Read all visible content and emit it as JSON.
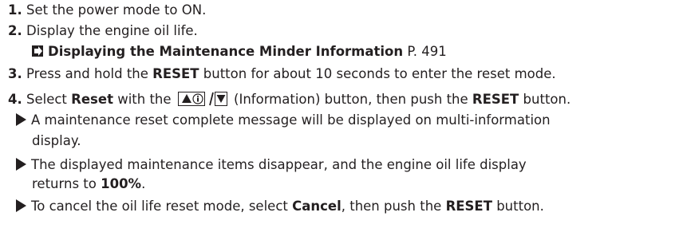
{
  "steps": [
    {
      "num": "1.",
      "text": "Set the power mode to ON."
    },
    {
      "num": "2.",
      "text": "Display the engine oil life."
    },
    {
      "num": "3.",
      "pre": "Press and hold the ",
      "bold": "RESET",
      "post": " button for about 10 seconds to enter the reset mode."
    },
    {
      "num": "4.",
      "pre": "Select ",
      "bold1": "Reset",
      "mid": " with the ",
      "button_suffix": " (Information) button, then push the ",
      "bold2": "RESET",
      "post": " button."
    }
  ],
  "reference": {
    "title": "Displaying the Maintenance Minder Information",
    "page": "P. 491"
  },
  "substeps": [
    {
      "line1": "A maintenance reset complete message will be displayed on multi-information",
      "line2": "display."
    },
    {
      "line1": "The displayed maintenance items disappear, and the engine oil life display",
      "line2_pre": "returns to ",
      "line2_bold": "100%",
      "line2_post": "."
    },
    {
      "pre": "To cancel the oil life reset mode, select ",
      "bold1": "Cancel",
      "mid": ", then push the ",
      "bold2": "RESET",
      "post": " button."
    }
  ],
  "icons": {
    "button": "up-info-down-button-icon",
    "bullet": "triangle-bullet-icon",
    "reference": "reference-arrow-icon"
  }
}
